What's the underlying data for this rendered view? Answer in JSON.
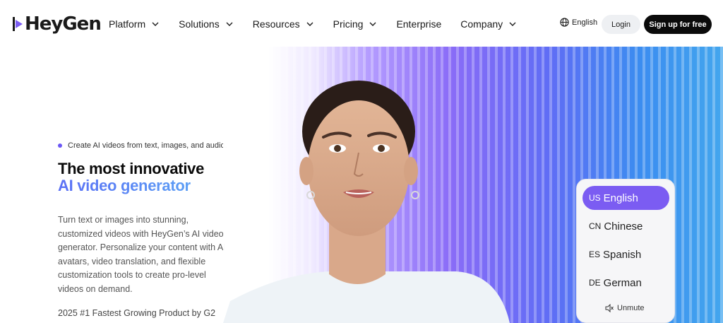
{
  "brand": {
    "name": "HeyGen"
  },
  "nav": {
    "items": [
      {
        "label": "Platform",
        "has_dropdown": true
      },
      {
        "label": "Solutions",
        "has_dropdown": true
      },
      {
        "label": "Resources",
        "has_dropdown": true
      },
      {
        "label": "Pricing",
        "has_dropdown": true
      },
      {
        "label": "Enterprise",
        "has_dropdown": false
      },
      {
        "label": "Company",
        "has_dropdown": true
      }
    ],
    "language": "English",
    "login": "Login",
    "signup": "Sign up for free"
  },
  "hero": {
    "tagline": "Create AI videos from text, images, and audio.",
    "title_line1": "The most innovative",
    "title_line2": "AI video generator",
    "description": "Turn text or images into stunning, customized videos with HeyGen’s AI video generator. Personalize your content with AI avatars, video translation, and flexible customization tools to create pro-level videos on demand.",
    "award": "2025 #1 Fastest Growing Product by G2"
  },
  "video": {
    "languages": [
      {
        "code": "US",
        "label": "English",
        "active": true
      },
      {
        "code": "CN",
        "label": "Chinese",
        "active": false
      },
      {
        "code": "ES",
        "label": "Spanish",
        "active": false
      },
      {
        "code": "DE",
        "label": "German",
        "active": false
      }
    ],
    "unmute_label": "Unmute"
  },
  "colors": {
    "accent": "#7b5cf2",
    "gradient_start": "#5a6ff5",
    "gradient_end": "#5d9ff5",
    "button_dark": "#0b0b0b"
  }
}
